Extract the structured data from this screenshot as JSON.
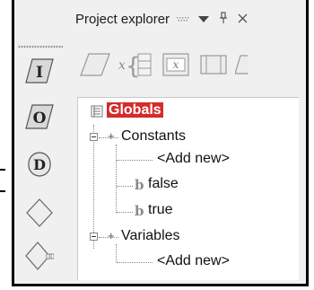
{
  "panel": {
    "title": "Project explorer",
    "header_icons": [
      "options-icon",
      "dropdown-arrow-icon",
      "pin-icon",
      "close-icon"
    ]
  },
  "left_toolbar": {
    "shapes": [
      {
        "name": "input-shape-icon",
        "letter": "I"
      },
      {
        "name": "output-shape-icon",
        "letter": "O"
      },
      {
        "name": "declare-shape-icon",
        "letter": "D"
      },
      {
        "name": "decision-shape-icon",
        "letter": ""
      },
      {
        "name": "loop-shape-icon",
        "letter": ""
      }
    ]
  },
  "top_toolbar": {
    "items": [
      "parallelogram-icon",
      "brace-block-icon",
      "assignment-icon",
      "call-icon",
      "more-icon"
    ],
    "x_symbol": "x"
  },
  "tree": {
    "root": "Globals",
    "constants": {
      "label": "Constants",
      "children": [
        "<Add new>",
        "false",
        "true"
      ]
    },
    "variables": {
      "label": "Variables",
      "children": [
        "<Add new>"
      ]
    },
    "bool_symbol": "b"
  },
  "colors": {
    "globals_highlight": "#d42b2b",
    "frame_border": "#000000"
  }
}
